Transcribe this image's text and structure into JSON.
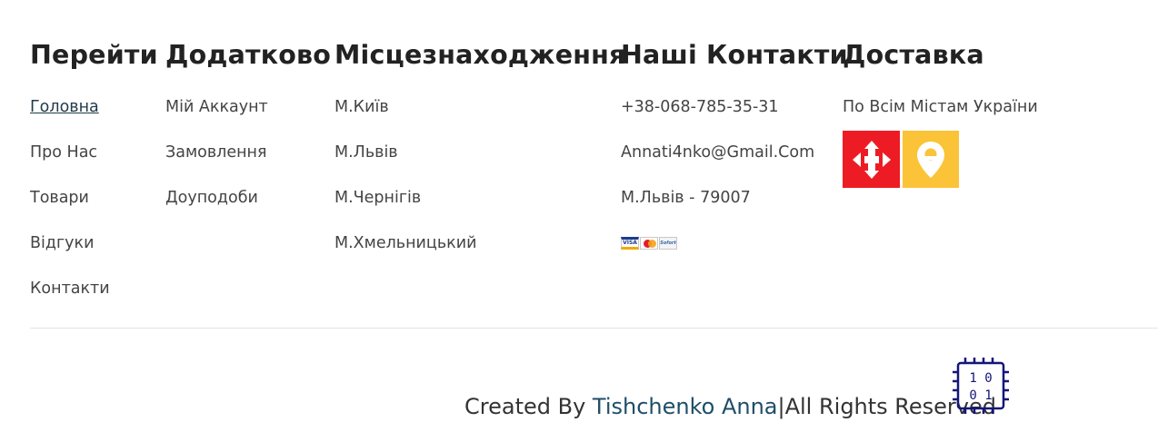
{
  "columns": {
    "go": {
      "title": "Перейти",
      "links": [
        "Головна",
        "Про Нас",
        "Товари",
        "Відгуки",
        "Контакти"
      ]
    },
    "extra": {
      "title": "Додатково",
      "links": [
        "Мій Аккаунт",
        "Замовлення",
        "Доуподоби"
      ]
    },
    "location": {
      "title": "Місцезнаходження",
      "items": [
        "М.Київ",
        "М.Львів",
        "М.Чернігів",
        "М.Хмельницький"
      ]
    },
    "contacts": {
      "title": "Наші Контакти",
      "phone": "+38-068-785-35-31",
      "email": "Annati4nko@Gmail.Com",
      "address": "М.Львів - 79007",
      "payment_icons": [
        "visa-card-icon",
        "mastercard-icon",
        "sofort-icon"
      ],
      "payment_labels": {
        "visa": "VISA",
        "sofort": "Sofort"
      }
    },
    "delivery": {
      "title": "Доставка",
      "text": "По Всім Містам України",
      "logos": [
        "nova-poshta-logo",
        "ukrposhta-logo"
      ]
    }
  },
  "footer": {
    "created_by": "Created By ",
    "author": "Tishchenko Anna",
    "rights": "|All Rights Reserved ",
    "chip_icon": "binary-chip-icon",
    "chip_text": [
      "1 0",
      "0 1"
    ]
  },
  "colors": {
    "heading": "#222222",
    "link": "#444444",
    "author_link": "#1f4e68",
    "nova_poshta_red": "#ed1c24",
    "ukrposhta_yellow": "#fbc337",
    "chip_blue": "#15157a"
  }
}
